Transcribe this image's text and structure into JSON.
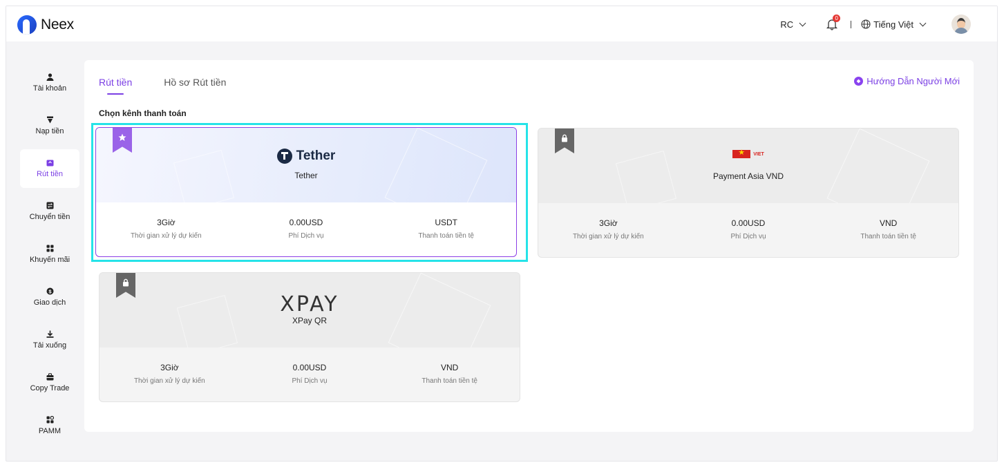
{
  "brand": {
    "logo_text": "Neex"
  },
  "header": {
    "account": "RC",
    "notification_count": "0",
    "separator": "I",
    "language": "Tiếng Việt"
  },
  "sidebar": {
    "items": [
      {
        "label": "Tài khoản",
        "icon": "user-icon"
      },
      {
        "label": "Nạp tiền",
        "icon": "deposit-icon"
      },
      {
        "label": "Rút tiền",
        "icon": "withdraw-icon",
        "active": true
      },
      {
        "label": "Chuyển tiền",
        "icon": "transfer-icon"
      },
      {
        "label": "Khuyến mãi",
        "icon": "promotion-icon"
      },
      {
        "label": "Giao dịch",
        "icon": "trade-icon"
      },
      {
        "label": "Tải xuống",
        "icon": "download-icon"
      },
      {
        "label": "Copy Trade",
        "icon": "briefcase-icon"
      },
      {
        "label": "PAMM",
        "icon": "pamm-icon"
      }
    ]
  },
  "main": {
    "tabs": [
      {
        "label": "Rút tiền",
        "active": true
      },
      {
        "label": "Hồ sơ Rút tiền",
        "active": false
      }
    ],
    "guide_link": "Hướng Dẫn Người Mới",
    "section_title": "Chọn kênh thanh toán",
    "channels": [
      {
        "name": "Tether",
        "logo_text": "Tether",
        "state": "selected",
        "time_value": "3Giờ",
        "time_label": "Thời gian xử lý dự kiến",
        "fee_value": "0.00USD",
        "fee_label": "Phí Dịch vụ",
        "currency_value": "USDT",
        "currency_label": "Thanh toán tiền tệ"
      },
      {
        "name": "Payment Asia VND",
        "logo_text": "VIET",
        "state": "locked",
        "time_value": "3Giờ",
        "time_label": "Thời gian xử lý dự kiến",
        "fee_value": "0.00USD",
        "fee_label": "Phí Dịch vụ",
        "currency_value": "VND",
        "currency_label": "Thanh toán tiền tệ"
      },
      {
        "name": "XPay QR",
        "logo_text": "XPAY",
        "state": "locked",
        "time_value": "3Giờ",
        "time_label": "Thời gian xử lý dự kiến",
        "fee_value": "0.00USD",
        "fee_label": "Phí Dịch vụ",
        "currency_value": "VND",
        "currency_label": "Thanh toán tiền tệ"
      }
    ]
  },
  "colors": {
    "accent": "#7b3fe4",
    "selection_outline": "#25e3e8",
    "ribbon_locked": "#666666"
  }
}
